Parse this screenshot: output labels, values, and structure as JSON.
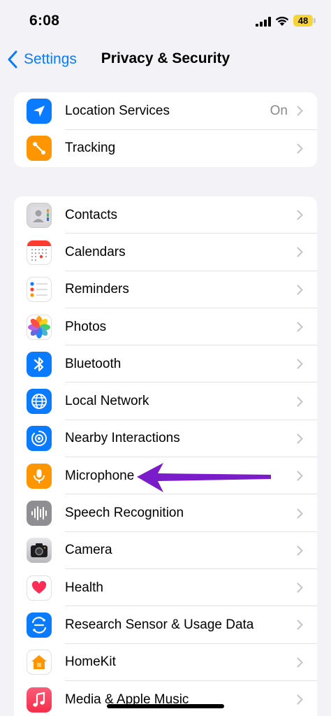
{
  "status_bar": {
    "time": "6:08",
    "battery": "48"
  },
  "nav": {
    "back_label": "Settings",
    "title": "Privacy & Security"
  },
  "group1": [
    {
      "label": "Location Services",
      "value": "On",
      "icon": "location-arrow-icon",
      "color": "#0a7aff"
    },
    {
      "label": "Tracking",
      "value": "",
      "icon": "tracking-icon",
      "color": "#ff9500"
    }
  ],
  "group2": [
    {
      "label": "Contacts",
      "icon": "contacts-icon"
    },
    {
      "label": "Calendars",
      "icon": "calendar-icon"
    },
    {
      "label": "Reminders",
      "icon": "reminders-icon"
    },
    {
      "label": "Photos",
      "icon": "photos-icon"
    },
    {
      "label": "Bluetooth",
      "icon": "bluetooth-icon"
    },
    {
      "label": "Local Network",
      "icon": "globe-icon"
    },
    {
      "label": "Nearby Interactions",
      "icon": "nearby-icon"
    },
    {
      "label": "Microphone",
      "icon": "microphone-icon"
    },
    {
      "label": "Speech Recognition",
      "icon": "waveform-icon"
    },
    {
      "label": "Camera",
      "icon": "camera-icon"
    },
    {
      "label": "Health",
      "icon": "heart-icon"
    },
    {
      "label": "Research Sensor & Usage Data",
      "icon": "research-icon"
    },
    {
      "label": "HomeKit",
      "icon": "home-icon"
    },
    {
      "label": "Media & Apple Music",
      "icon": "music-note-icon"
    }
  ],
  "colors": {
    "accent": "#0a7aff",
    "background": "#f2f2f7",
    "annotation_arrow": "#7a1cc9",
    "battery": "#f5d43a"
  }
}
